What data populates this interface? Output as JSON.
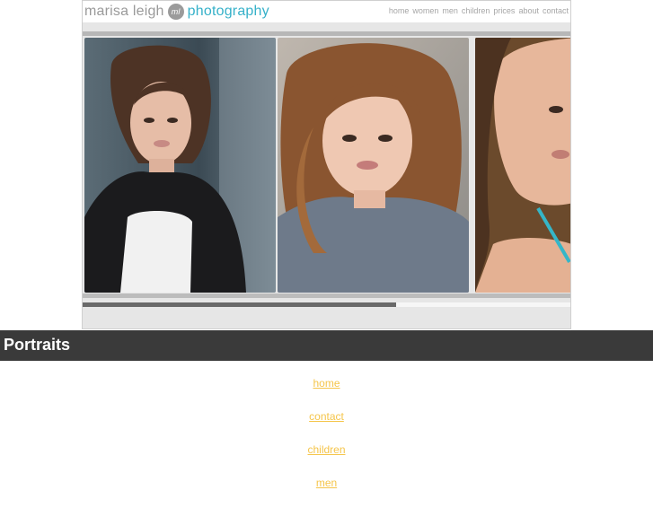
{
  "banner": {
    "logo": {
      "name": "marisa leigh",
      "monogram": "ml",
      "word": "photography"
    },
    "nav": [
      "home",
      "women",
      "men",
      "children",
      "prices",
      "about",
      "contact"
    ],
    "photos": [
      {
        "alt": "woman in black leather jacket portrait"
      },
      {
        "alt": "woman in grey t-shirt portrait"
      },
      {
        "alt": "woman with teal strap portrait"
      }
    ],
    "progress_fraction": 0.64
  },
  "section": {
    "title": "Portraits"
  },
  "links": [
    "home",
    "contact",
    "children",
    "men"
  ],
  "colors": {
    "accent": "#36b1c9",
    "link": "#f5c54a",
    "header_bg": "#3a3a3a"
  }
}
